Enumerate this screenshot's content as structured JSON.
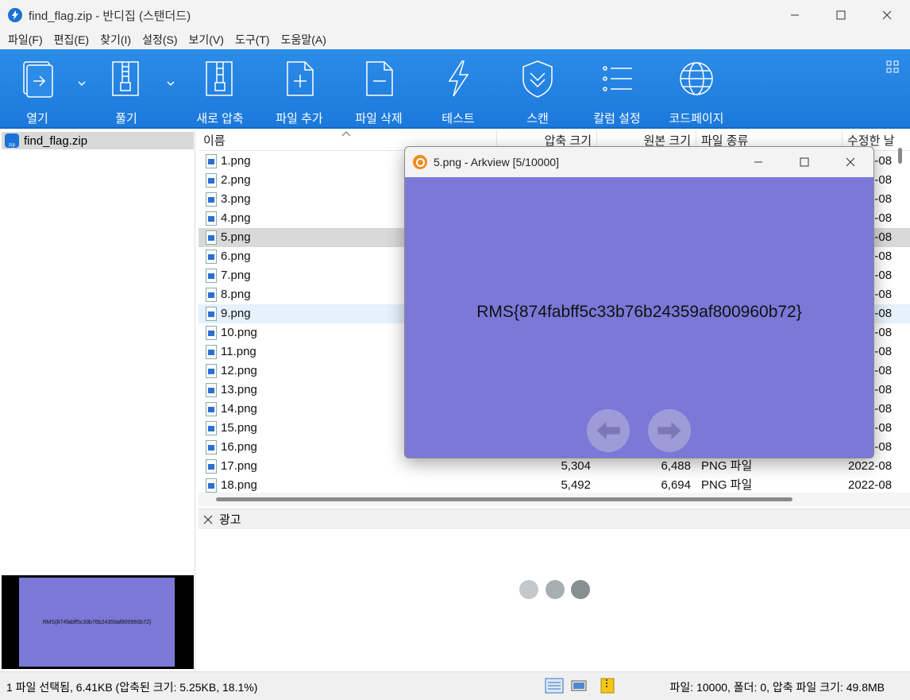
{
  "window": {
    "title": "find_flag.zip - 반디집 (스탠더드)"
  },
  "menu": [
    "파일(F)",
    "편집(E)",
    "찾기(I)",
    "설정(S)",
    "보기(V)",
    "도구(T)",
    "도움말(A)"
  ],
  "toolbar": {
    "open": "열기",
    "extract": "풀기",
    "new_archive": "새로 압축",
    "add_file": "파일 추가",
    "delete_file": "파일 삭제",
    "test": "테스트",
    "scan": "스캔",
    "column_settings": "칼럼 설정",
    "codepage": "코드페이지"
  },
  "tree": {
    "archive": "find_flag.zip"
  },
  "columns": {
    "name": "이름",
    "compressed": "압축 크기",
    "original": "원본 크기",
    "type": "파일 종류",
    "modified": "수정한 날"
  },
  "files": [
    {
      "name": "1.png"
    },
    {
      "name": "2.png"
    },
    {
      "name": "3.png"
    },
    {
      "name": "4.png"
    },
    {
      "name": "5.png"
    },
    {
      "name": "6.png"
    },
    {
      "name": "7.png"
    },
    {
      "name": "8.png"
    },
    {
      "name": "9.png"
    },
    {
      "name": "10.png"
    },
    {
      "name": "11.png"
    },
    {
      "name": "12.png"
    },
    {
      "name": "13.png"
    },
    {
      "name": "14.png"
    },
    {
      "name": "15.png"
    },
    {
      "name": "16.png"
    },
    {
      "name": "17.png",
      "compressed": "5,304",
      "original": "6,488",
      "type": "PNG 파일"
    },
    {
      "name": "18.png",
      "compressed": "5,492",
      "original": "6,694",
      "type": "PNG 파일"
    }
  ],
  "date_fragment": "2022-08",
  "selected_file": "5.png",
  "hover_file": "9.png",
  "ad": {
    "label": "광고"
  },
  "status": {
    "left": "1 파일 선택됨, 6.41KB (압축된 크기: 5.25KB, 18.1%)",
    "right": "파일: 10000, 폴더: 0, 압축 파일 크기: 49.8MB"
  },
  "arkview": {
    "title": "5.png - Arkview [5/10000]",
    "image_text": "RMS{874fabff5c33b76b24359af800960b72}"
  },
  "preview": {
    "text": "RMS{874fabff5c33b76b24359af800960b72}"
  },
  "colors": {
    "toolbar": "#1c79dc",
    "image_bg": "#7b78d8",
    "accent": "#1a72d6"
  }
}
